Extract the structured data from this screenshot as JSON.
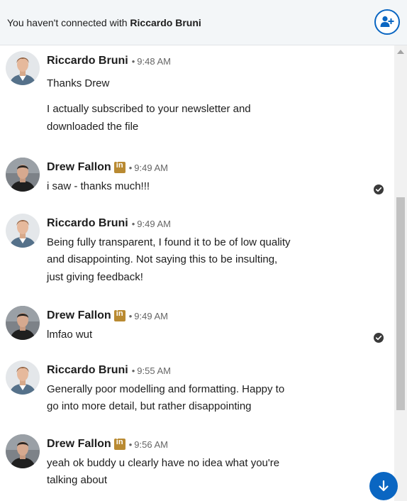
{
  "banner": {
    "prefix": "You haven't connected with",
    "name": "Riccardo Bruni",
    "connect_icon": "add-person-icon"
  },
  "badge_text": "in",
  "messages": [
    {
      "sender": "Riccardo Bruni",
      "time": "9:48 AM",
      "linkedin_badge": false,
      "lines": [
        "Thanks Drew",
        "I actually subscribed to your newsletter and",
        "downloaded the file"
      ]
    },
    {
      "sender": "Drew Fallon",
      "time": "9:49 AM",
      "linkedin_badge": true,
      "lines": [
        "i saw - thanks much!!!"
      ],
      "read_receipt": true
    },
    {
      "sender": "Riccardo Bruni",
      "time": "9:49 AM",
      "linkedin_badge": false,
      "lines": [
        "Being fully transparent, I found it to be of low quality",
        "and disappointing. Not saying this to be insulting,",
        "just giving feedback!"
      ]
    },
    {
      "sender": "Drew Fallon",
      "time": "9:49 AM",
      "linkedin_badge": true,
      "lines": [
        "lmfao wut"
      ],
      "read_receipt": true
    },
    {
      "sender": "Riccardo Bruni",
      "time": "9:55 AM",
      "linkedin_badge": false,
      "lines": [
        "Generally poor modelling and formatting. Happy to",
        "go into more detail, but rather disappointing"
      ]
    },
    {
      "sender": "Drew Fallon",
      "time": "9:56 AM",
      "linkedin_badge": true,
      "lines": [
        "yeah ok buddy u clearly have no idea what you're",
        "talking about"
      ]
    }
  ],
  "scroll_down_icon": "arrow-down-icon"
}
